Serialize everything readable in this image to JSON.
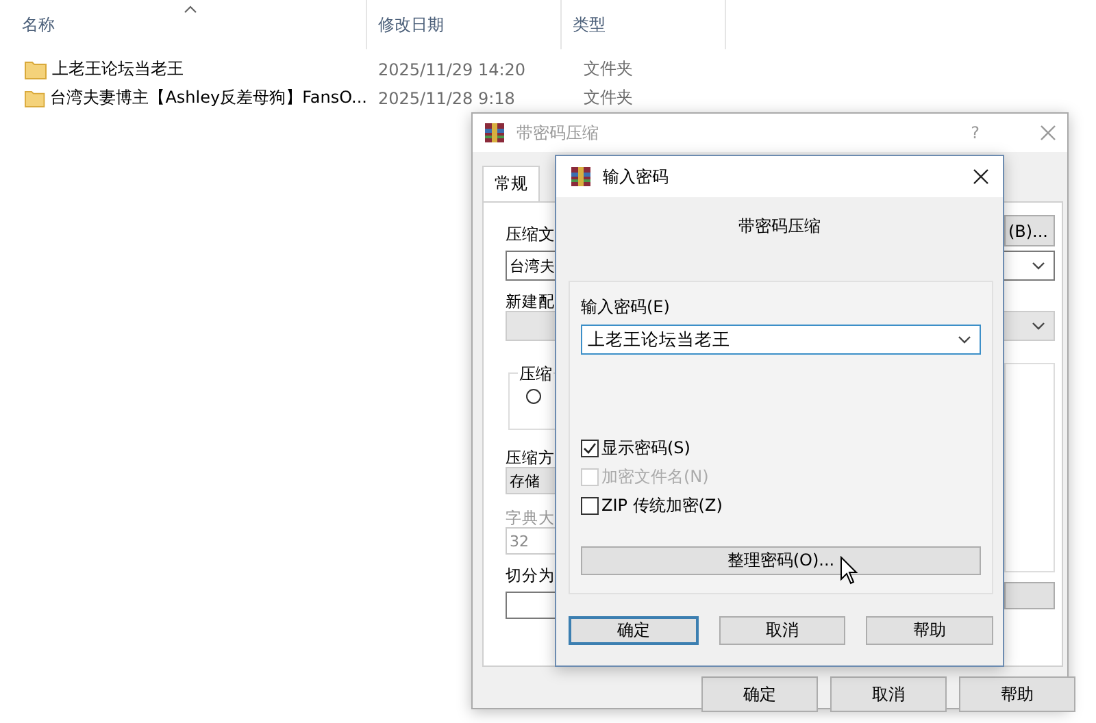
{
  "file_list": {
    "columns": [
      "名称",
      "修改日期",
      "类型"
    ],
    "rows": [
      {
        "name": "上老王论坛当老王",
        "modified": "2025/11/29 14:20",
        "type": "文件夹"
      },
      {
        "name": "台湾夫妻博主【Ashley反差母狗】FansO...",
        "modified": "2025/11/28 9:18",
        "type": "文件夹"
      }
    ]
  },
  "back_dialog": {
    "title": "带密码压缩",
    "help_glyph": "?",
    "tabs": [
      {
        "label": "常规",
        "selected": true
      }
    ],
    "archive_name_label": "压缩文",
    "browse_button": "(B)...",
    "archive_name_value": "台湾夫",
    "profile_label": "新建配",
    "group_label": "压缩",
    "radio": {
      "selected": false
    },
    "method_label": "压缩方",
    "method_value": "存储",
    "dictionary_label": "字典大",
    "dictionary_value": "32",
    "dictionary_disabled": true,
    "split_label": "切分为",
    "buttons": [
      "确定",
      "取消",
      "帮助"
    ]
  },
  "front_dialog": {
    "title": "输入密码",
    "heading": "带密码压缩",
    "password_label": "输入密码(E)",
    "password_value": "上老王论坛当老王",
    "checkboxes": [
      {
        "label": "显示密码(S)",
        "checked": true,
        "disabled": false
      },
      {
        "label": "加密文件名(N)",
        "checked": false,
        "disabled": true
      },
      {
        "label": "ZIP 传统加密(Z)",
        "checked": false,
        "disabled": false
      }
    ],
    "manage_button": "整理密码(O)...",
    "buttons": [
      {
        "label": "确定",
        "default": true
      },
      {
        "label": "取消",
        "default": false
      },
      {
        "label": "帮助",
        "default": false
      }
    ]
  }
}
